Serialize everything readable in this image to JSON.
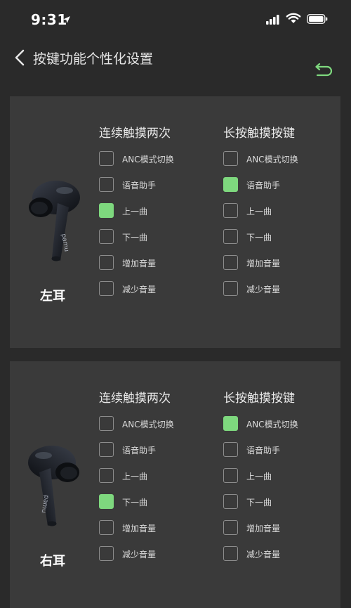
{
  "status": {
    "time": "9:31"
  },
  "nav": {
    "title": "按键功能个性化设置"
  },
  "colors": {
    "accent": "#7ed87e",
    "background": "#2a2a2a",
    "panel": "#3a3a3a"
  },
  "panels": [
    {
      "ear_label": "左耳",
      "columns": [
        {
          "title": "连续触摸两次",
          "options": [
            {
              "label": "ANC模式切换",
              "checked": false
            },
            {
              "label": "语音助手",
              "checked": false
            },
            {
              "label": "上一曲",
              "checked": true
            },
            {
              "label": "下一曲",
              "checked": false
            },
            {
              "label": "增加音量",
              "checked": false
            },
            {
              "label": "减少音量",
              "checked": false
            }
          ]
        },
        {
          "title": "长按触摸按键",
          "options": [
            {
              "label": "ANC模式切换",
              "checked": false
            },
            {
              "label": "语音助手",
              "checked": true
            },
            {
              "label": "上一曲",
              "checked": false
            },
            {
              "label": "下一曲",
              "checked": false
            },
            {
              "label": "增加音量",
              "checked": false
            },
            {
              "label": "减少音量",
              "checked": false
            }
          ]
        }
      ]
    },
    {
      "ear_label": "右耳",
      "columns": [
        {
          "title": "连续触摸两次",
          "options": [
            {
              "label": "ANC模式切换",
              "checked": false
            },
            {
              "label": "语音助手",
              "checked": false
            },
            {
              "label": "上一曲",
              "checked": false
            },
            {
              "label": "下一曲",
              "checked": true
            },
            {
              "label": "增加音量",
              "checked": false
            },
            {
              "label": "减少音量",
              "checked": false
            }
          ]
        },
        {
          "title": "长按触摸按键",
          "options": [
            {
              "label": "ANC模式切换",
              "checked": true
            },
            {
              "label": "语音助手",
              "checked": false
            },
            {
              "label": "上一曲",
              "checked": false
            },
            {
              "label": "下一曲",
              "checked": false
            },
            {
              "label": "增加音量",
              "checked": false
            },
            {
              "label": "减少音量",
              "checked": false
            }
          ]
        }
      ]
    }
  ]
}
